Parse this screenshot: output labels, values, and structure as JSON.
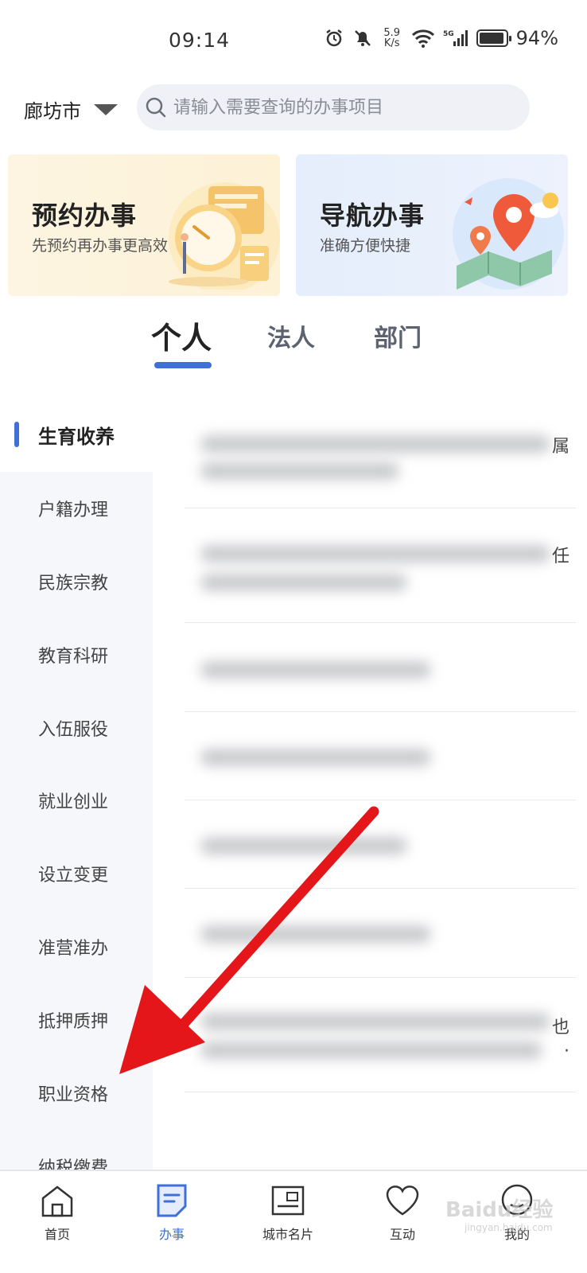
{
  "status_bar": {
    "time": "09:14",
    "net_speed_top": "5.9",
    "net_speed_bottom": "K/s",
    "signal_label": "5G",
    "battery_percent": 94,
    "battery_text": "94%"
  },
  "header": {
    "city": "廊坊市",
    "search_placeholder": "请输入需要查询的办事项目"
  },
  "banners": [
    {
      "title": "预约办事",
      "subtitle": "先预约再办事更高效"
    },
    {
      "title": "导航办事",
      "subtitle": "准确方便快捷"
    }
  ],
  "tabs": [
    {
      "label": "个人",
      "active": true
    },
    {
      "label": "法人",
      "active": false
    },
    {
      "label": "部门",
      "active": false
    }
  ],
  "categories": [
    {
      "label": "生育收养",
      "active": true
    },
    {
      "label": "户籍办理"
    },
    {
      "label": "民族宗教"
    },
    {
      "label": "教育科研"
    },
    {
      "label": "入伍服役"
    },
    {
      "label": "就业创业"
    },
    {
      "label": "设立变更"
    },
    {
      "label": "准营准办"
    },
    {
      "label": "抵押质押"
    },
    {
      "label": "职业资格"
    },
    {
      "label": "纳税缴费"
    }
  ],
  "list_edge_chars": [
    "属",
    "任",
    "也",
    "·"
  ],
  "bottom_nav": [
    {
      "label": "首页",
      "icon": "home-icon",
      "active": false
    },
    {
      "label": "办事",
      "icon": "document-icon",
      "active": true
    },
    {
      "label": "城市名片",
      "icon": "postcard-icon",
      "active": false
    },
    {
      "label": "互动",
      "icon": "heart-icon",
      "active": false
    },
    {
      "label": "我的",
      "icon": "profile-icon",
      "active": false
    }
  ],
  "watermark": {
    "main": "Baidu经验",
    "sub": "jingyan.baidu.com"
  },
  "colors": {
    "accent": "#3f6fd8",
    "arrow": "#e5161a",
    "appoint_card_bg": "#fdf3dc",
    "nav_card_bg": "#e8f0fc"
  }
}
